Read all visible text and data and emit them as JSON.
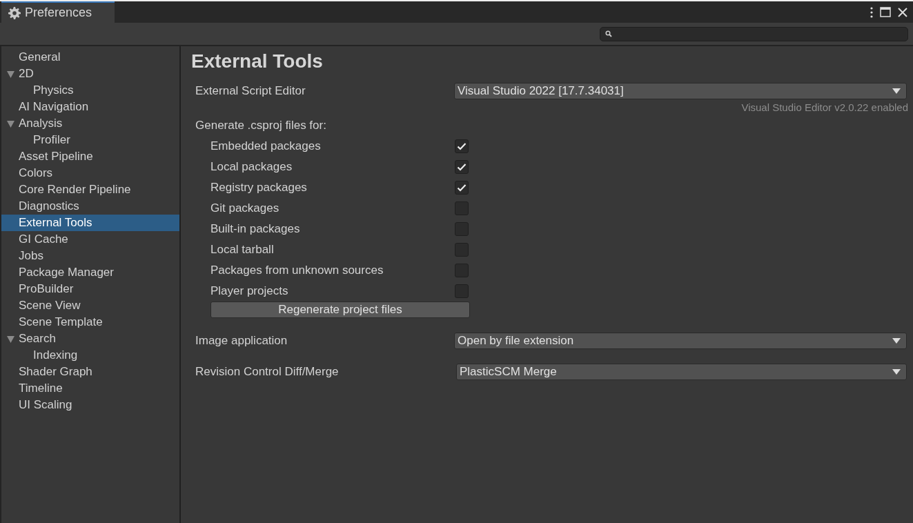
{
  "window": {
    "title": "Preferences"
  },
  "sidebar": {
    "items": [
      {
        "label": "General",
        "selected": false
      },
      {
        "label": "2D",
        "selected": false,
        "expanded": true,
        "children": [
          {
            "label": "Physics",
            "selected": false
          }
        ]
      },
      {
        "label": "AI Navigation",
        "selected": false
      },
      {
        "label": "Analysis",
        "selected": false,
        "expanded": true,
        "children": [
          {
            "label": "Profiler",
            "selected": false
          }
        ]
      },
      {
        "label": "Asset Pipeline",
        "selected": false
      },
      {
        "label": "Colors",
        "selected": false
      },
      {
        "label": "Core Render Pipeline",
        "selected": false
      },
      {
        "label": "Diagnostics",
        "selected": false
      },
      {
        "label": "External Tools",
        "selected": true
      },
      {
        "label": "GI Cache",
        "selected": false
      },
      {
        "label": "Jobs",
        "selected": false
      },
      {
        "label": "Package Manager",
        "selected": false
      },
      {
        "label": "ProBuilder",
        "selected": false
      },
      {
        "label": "Scene View",
        "selected": false
      },
      {
        "label": "Scene Template",
        "selected": false
      },
      {
        "label": "Search",
        "selected": false,
        "expanded": true,
        "children": [
          {
            "label": "Indexing",
            "selected": false
          }
        ]
      },
      {
        "label": "Shader Graph",
        "selected": false
      },
      {
        "label": "Timeline",
        "selected": false
      },
      {
        "label": "UI Scaling",
        "selected": false
      }
    ]
  },
  "content": {
    "heading": "External Tools",
    "script_editor": {
      "label": "External Script Editor",
      "value": "Visual Studio 2022 [17.7.34031]",
      "note": "Visual Studio Editor v2.0.22 enabled"
    },
    "generate": {
      "label": "Generate .csproj files for:",
      "options": [
        {
          "label": "Embedded packages",
          "checked": true
        },
        {
          "label": "Local packages",
          "checked": true
        },
        {
          "label": "Registry packages",
          "checked": true
        },
        {
          "label": "Git packages",
          "checked": false
        },
        {
          "label": "Built-in packages",
          "checked": false
        },
        {
          "label": "Local tarball",
          "checked": false
        },
        {
          "label": "Packages from unknown sources",
          "checked": false
        },
        {
          "label": "Player projects",
          "checked": false
        }
      ],
      "button": "Regenerate project files"
    },
    "image_application": {
      "label": "Image application",
      "value": "Open by file extension"
    },
    "revision_control": {
      "label": "Revision Control Diff/Merge",
      "value": "PlasticSCM Merge"
    }
  }
}
